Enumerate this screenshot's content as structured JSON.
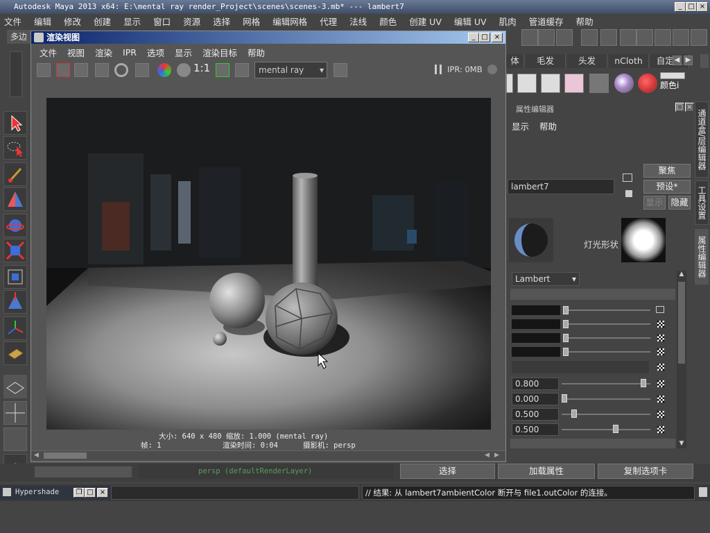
{
  "app": {
    "title": "Autodesk Maya 2013 x64: E:\\mental ray render_Project\\scenes\\scenes-3.mb*   ---   lambert7",
    "window_buttons": [
      "_",
      "□",
      "×"
    ]
  },
  "menubar": [
    "文件",
    "编辑",
    "修改",
    "创建",
    "显示",
    "窗口",
    "资源",
    "选择",
    "网格",
    "编辑网格",
    "代理",
    "法线",
    "颜色",
    "创建 UV",
    "编辑 UV",
    "肌肉",
    "管道缓存",
    "帮助"
  ],
  "mode_label": "多边",
  "render_view": {
    "title": "渲染视图",
    "menu": [
      "文件",
      "视图",
      "渲染",
      "IPR",
      "选项",
      "显示",
      "渲染目标",
      "帮助"
    ],
    "ratio_label": "1:1",
    "renderer": "mental ray",
    "ipr_status": "IPR: 0MB",
    "info_line1": "大小: 640 x 480 缩放: 1.000         (mental ray)",
    "info_frame": "帧: 1",
    "info_time": "渲染时间: 0:04",
    "info_camera": "摄影机: persp"
  },
  "shelf_tabs": [
    "体",
    "毛发",
    "头发",
    "nCloth",
    "自定义"
  ],
  "shelf_last_label": "颜色i",
  "attribute_editor": {
    "title": "属性编辑器",
    "menu": [
      "显示",
      "帮助"
    ],
    "node_name": "lambert7",
    "focus_button": "聚焦",
    "presets_button": "预设*",
    "show_button": "显示",
    "hide_button": "隐藏",
    "light_shape_label": "灯光形状",
    "type_select": "Lambert",
    "values": [
      "0.800",
      "0.000",
      "0.500",
      "0.500"
    ],
    "value_levels": [
      0.95,
      0.0,
      0.12,
      0.62
    ]
  },
  "side_tabs": [
    "通道盒/层编辑器",
    "工具设置",
    "属性编辑器"
  ],
  "bottom": {
    "viewport_label": "persp (defaultRenderLayer)",
    "select_button": "选择",
    "load_attr_button": "加载属性",
    "copy_tab_button": "复制选项卡"
  },
  "hypershade": {
    "title": "Hypershade"
  },
  "command_output": "// 结果: 从 lambert7ambientColor 断开与 file1.outColor 的连接。"
}
